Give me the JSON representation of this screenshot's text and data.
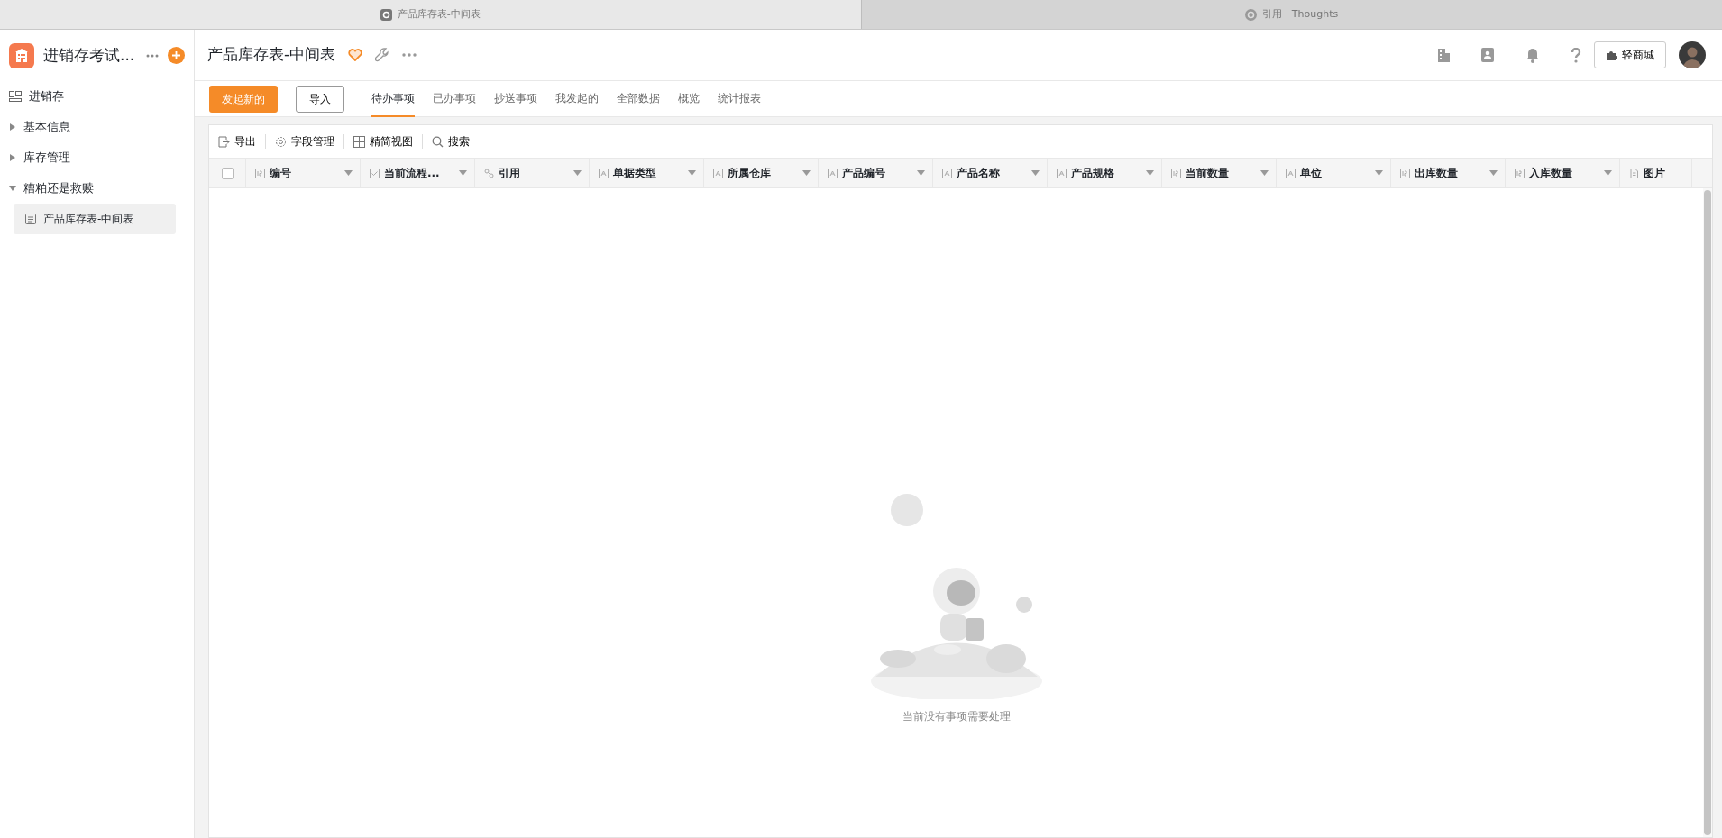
{
  "browser_tabs": [
    {
      "label": "产品库存表-中间表",
      "selected": true
    },
    {
      "label": "引用 · Thoughts",
      "selected": false
    }
  ],
  "app": {
    "name": "进销存考试...",
    "title": "产品库存表-中间表",
    "favorited": true
  },
  "sidebar": {
    "items": [
      {
        "label": "进销存",
        "kind": "home"
      },
      {
        "label": "基本信息",
        "kind": "group",
        "expanded": false
      },
      {
        "label": "库存管理",
        "kind": "group",
        "expanded": false
      },
      {
        "label": "糟粕还是救赎",
        "kind": "group",
        "expanded": true,
        "children": [
          {
            "label": "产品库存表-中间表",
            "selected": true
          }
        ]
      }
    ]
  },
  "header_actions": {
    "store_button": "轻商城"
  },
  "actions": {
    "primary": "发起新的",
    "secondary": "导入"
  },
  "tabs": [
    {
      "label": "待办事项",
      "selected": true
    },
    {
      "label": "已办事项",
      "selected": false
    },
    {
      "label": "抄送事项",
      "selected": false
    },
    {
      "label": "我发起的",
      "selected": false
    },
    {
      "label": "全部数据",
      "selected": false
    },
    {
      "label": "概览",
      "selected": false
    },
    {
      "label": "统计报表",
      "selected": false
    }
  ],
  "toolbar": [
    {
      "label": "导出",
      "kind": "export"
    },
    {
      "label": "字段管理",
      "kind": "settings"
    },
    {
      "label": "精简视图",
      "kind": "grid"
    },
    {
      "label": "搜索",
      "kind": "search"
    }
  ],
  "table": {
    "select_all": false,
    "columns": [
      {
        "label": "编号",
        "kind": "number",
        "menu": true
      },
      {
        "label": "当前流程...",
        "kind": "check",
        "menu": true
      },
      {
        "label": "引用",
        "kind": "link",
        "menu": true
      },
      {
        "label": "单据类型",
        "kind": "text",
        "menu": true
      },
      {
        "label": "所属仓库",
        "kind": "text",
        "menu": true
      },
      {
        "label": "产品编号",
        "kind": "text",
        "menu": true
      },
      {
        "label": "产品名称",
        "kind": "text",
        "menu": true
      },
      {
        "label": "产品规格",
        "kind": "text",
        "menu": true
      },
      {
        "label": "当前数量",
        "kind": "number",
        "menu": true
      },
      {
        "label": "单位",
        "kind": "text",
        "menu": true
      },
      {
        "label": "出库数量",
        "kind": "number",
        "menu": true
      },
      {
        "label": "入库数量",
        "kind": "number",
        "menu": true
      },
      {
        "label": "图片",
        "kind": "file",
        "menu": false
      }
    ],
    "empty_message": "当前没有事项需要处理"
  }
}
